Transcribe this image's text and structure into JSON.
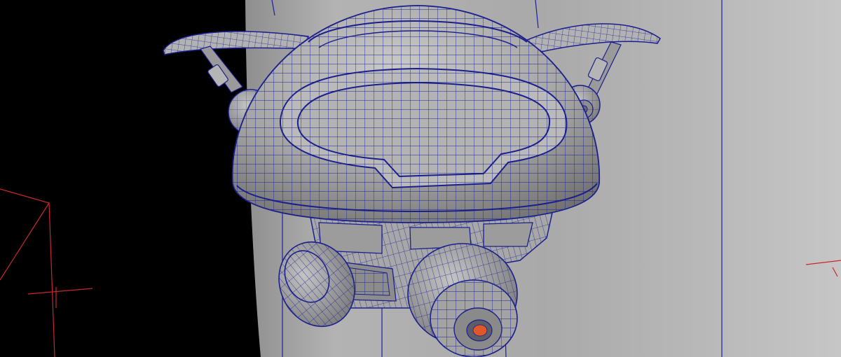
{
  "viewport": {
    "background_color": "#000000",
    "backdrop_color": "#a3a3a3",
    "wire_color": "#1a1f8c",
    "guide_line_color": "#1a1f9c",
    "locator_color": "#c8282a",
    "highlight_color": "#e0582a",
    "render_mode": "wireframe-on-shaded"
  },
  "model": {
    "icon": "robot-drone-icon"
  }
}
